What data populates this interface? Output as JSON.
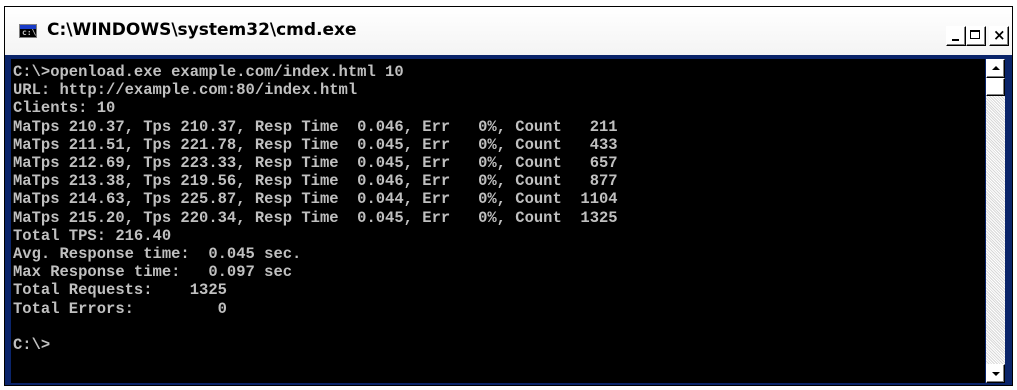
{
  "window": {
    "title": "C:\\WINDOWS\\system32\\cmd.exe",
    "icon": "console-icon",
    "icon_glyph": "c:\\",
    "buttons": {
      "minimize": "minimize-icon",
      "maximize": "maximize-icon",
      "close": "×"
    }
  },
  "colors": {
    "console_background": "#000000",
    "console_text": "#c0c0c0",
    "titlebar_background": "#ffffff"
  },
  "console": {
    "lines": [
      "C:\\>openload.exe example.com/index.html 10",
      "URL: http://example.com:80/index.html",
      "Clients: 10",
      "MaTps 210.37, Tps 210.37, Resp Time  0.046, Err   0%, Count   211",
      "MaTps 211.51, Tps 221.78, Resp Time  0.045, Err   0%, Count   433",
      "MaTps 212.69, Tps 223.33, Resp Time  0.045, Err   0%, Count   657",
      "MaTps 213.38, Tps 219.56, Resp Time  0.046, Err   0%, Count   877",
      "MaTps 214.63, Tps 225.87, Resp Time  0.044, Err   0%, Count  1104",
      "MaTps 215.20, Tps 220.34, Resp Time  0.045, Err   0%, Count  1325",
      "Total TPS: 216.40",
      "Avg. Response time:  0.045 sec.",
      "Max Response time:   0.097 sec",
      "Total Requests:    1325",
      "Total Errors:         0",
      "",
      "C:\\>"
    ]
  },
  "scrollbar": {
    "up_icon": "scroll-up-arrow-icon",
    "down_icon": "scroll-down-arrow-icon",
    "position_fraction": 0.0
  }
}
